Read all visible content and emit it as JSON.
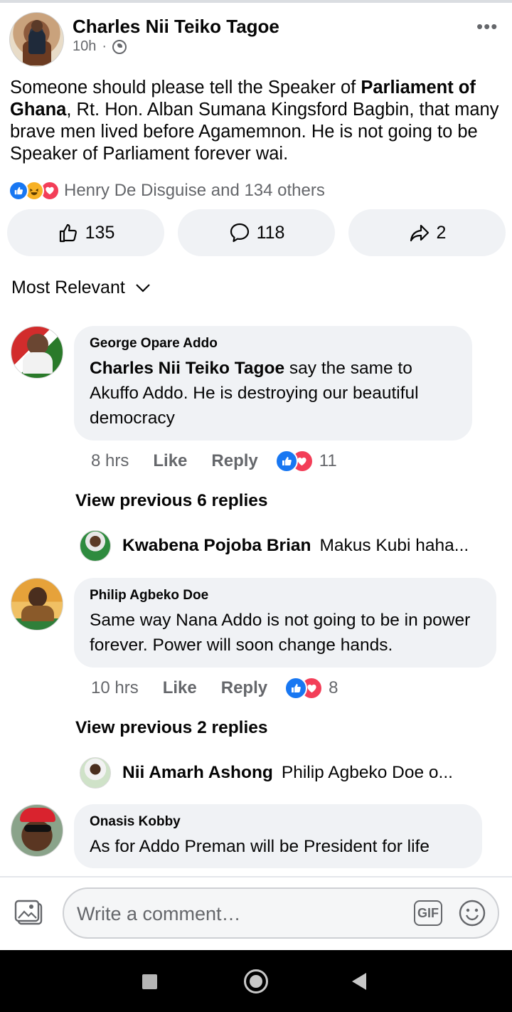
{
  "post": {
    "author": "Charles Nii Teiko Tagoe",
    "time": "10h",
    "separator": "·",
    "more": "•••",
    "text_part1": "Someone should please tell the Speaker of ",
    "text_bold": "Parliament of Ghana",
    "text_part2": ", Rt. Hon. Alban Sumana Kingsford Bagbin, that many brave men lived before Agamemnon. He is not going to be Speaker of Parliament forever wai.",
    "reactions_text": "Henry De Disguise and 134 others",
    "like_count": "135",
    "comment_count": "118",
    "share_count": "2"
  },
  "sort": {
    "label": "Most Relevant"
  },
  "comments": [
    {
      "name": "George Opare Addo",
      "mention": "Charles Nii Teiko Tagoe",
      "text": " say the same to Akuffo Addo. He is destroying our beautiful democracy",
      "time": "8 hrs",
      "like": "Like",
      "reply": "Reply",
      "reaction_count": "11",
      "view_previous": "View previous 6 replies",
      "reply_preview": {
        "name": "Kwabena Pojoba Brian",
        "text": "Makus Kubi haha..."
      }
    },
    {
      "name": "Philip Agbeko Doe",
      "text": "Same way Nana Addo is not going to be in power forever. Power will soon change hands.",
      "time": "10 hrs",
      "like": "Like",
      "reply": "Reply",
      "reaction_count": "8",
      "view_previous": "View previous 2 replies",
      "reply_preview": {
        "name": "Nii Amarh Ashong",
        "text": "Philip Agbeko Doe  o..."
      }
    },
    {
      "name": "Onasis Kobby",
      "text": "As for Addo Preman will be President for life"
    }
  ],
  "composer": {
    "placeholder": "Write a comment…",
    "gif_label": "GIF"
  },
  "colors": {
    "accent": "#1877f2",
    "love": "#f33e58",
    "bubble": "#f0f2f5",
    "secondary_text": "#65676b"
  },
  "icons": {
    "more": "more-dots-icon",
    "privacy": "globe-icon",
    "like": "thumbs-up-icon",
    "comment": "comment-bubble-icon",
    "share": "share-arrow-icon",
    "photo": "photo-icon",
    "emoji": "emoji-icon"
  }
}
